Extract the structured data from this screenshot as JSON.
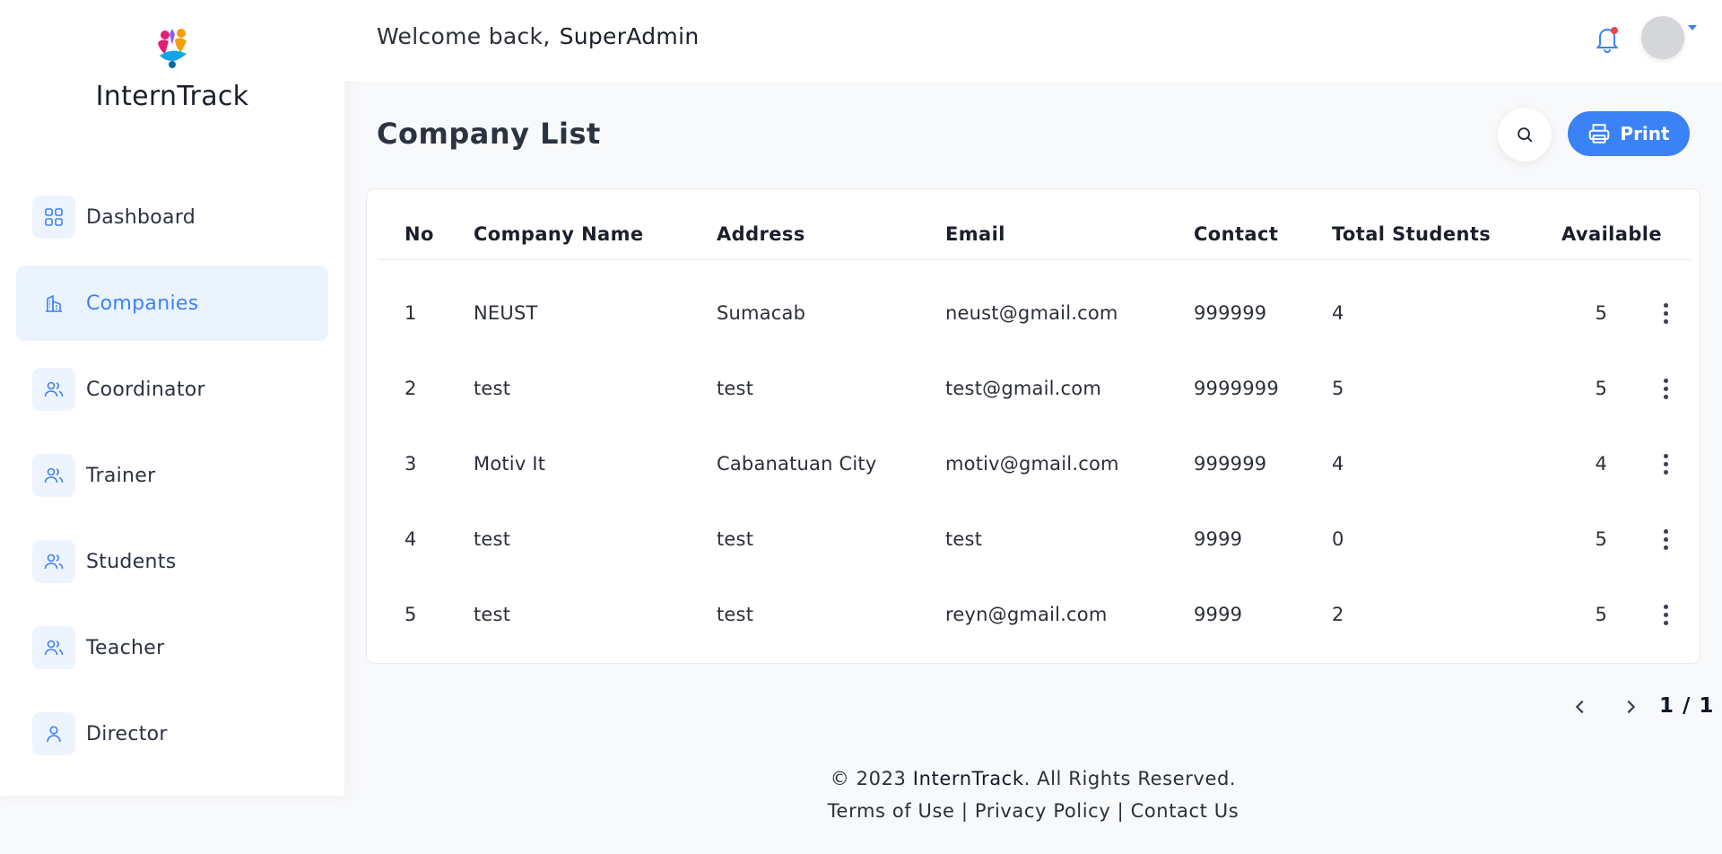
{
  "app": {
    "name": "InternTrack"
  },
  "sidebar": {
    "items": [
      {
        "label": "Dashboard",
        "icon": "grid-icon",
        "active": false
      },
      {
        "label": "Companies",
        "icon": "building-icon",
        "active": true
      },
      {
        "label": "Coordinator",
        "icon": "users-icon",
        "active": false
      },
      {
        "label": "Trainer",
        "icon": "users-icon",
        "active": false
      },
      {
        "label": "Students",
        "icon": "users-icon",
        "active": false
      },
      {
        "label": "Teacher",
        "icon": "users-icon",
        "active": false
      },
      {
        "label": "Director",
        "icon": "user-icon",
        "active": false
      }
    ]
  },
  "header": {
    "welcome": "Welcome back,",
    "username": "SuperAdmin"
  },
  "page": {
    "title": "Company List",
    "print_label": "Print"
  },
  "table": {
    "columns": [
      "No",
      "Company Name",
      "Address",
      "Email",
      "Contact",
      "Total Students",
      "Available"
    ],
    "rows": [
      {
        "no": "1",
        "name": "NEUST",
        "address": "Sumacab",
        "email": "neust@gmail.com",
        "contact": "999999",
        "total": "4",
        "available": "5"
      },
      {
        "no": "2",
        "name": "test",
        "address": "test",
        "email": "test@gmail.com",
        "contact": "9999999",
        "total": "5",
        "available": "5"
      },
      {
        "no": "3",
        "name": "Motiv It",
        "address": "Cabanatuan City",
        "email": "motiv@gmail.com",
        "contact": "999999",
        "total": "4",
        "available": "4"
      },
      {
        "no": "4",
        "name": "test",
        "address": "test",
        "email": "test",
        "contact": "9999",
        "total": "0",
        "available": "5"
      },
      {
        "no": "5",
        "name": "test",
        "address": "test",
        "email": "reyn@gmail.com",
        "contact": "9999",
        "total": "2",
        "available": "5"
      }
    ]
  },
  "pagination": {
    "indicator": "1 / 1"
  },
  "footer": {
    "copyright_prefix": "© 2023",
    "brand": "InternTrack",
    "copyright_suffix": ". All Rights Reserved.",
    "links": [
      "Terms of Use",
      "Privacy Policy",
      "Contact Us"
    ],
    "separator": "|"
  },
  "colors": {
    "accent": "#3b82f6",
    "active_bg": "#ebf3fe",
    "notification": "#ef4444"
  }
}
